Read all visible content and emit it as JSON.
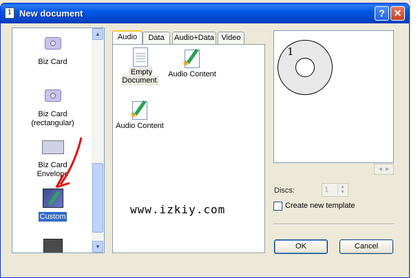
{
  "window": {
    "title": "New document",
    "help_label": "?",
    "close_label": "✕"
  },
  "templates": [
    {
      "label": "Biz Card",
      "icon": "disc-icon"
    },
    {
      "label": "Biz Card (rectangular)",
      "icon": "disc-icon"
    },
    {
      "label": "Biz Card Envelope",
      "icon": "envelope-icon"
    },
    {
      "label": "Custom",
      "icon": "custom-brush-icon",
      "selected": true
    }
  ],
  "tabs": [
    {
      "label": "Audio",
      "active": true
    },
    {
      "label": "Data"
    },
    {
      "label": "Audio+Data"
    },
    {
      "label": "Video"
    }
  ],
  "documents": [
    {
      "label": "Empty Document",
      "icon": "document-icon"
    },
    {
      "label": "Audio Content",
      "icon": "audio-document-icon"
    },
    {
      "label": "Audio Content",
      "icon": "audio-document-icon"
    }
  ],
  "watermark": "www.izkiy.com",
  "preview": {
    "disc_number": "1"
  },
  "discs": {
    "label": "Discs:",
    "value": "1"
  },
  "create_template": {
    "label": "Create new template",
    "checked": false
  },
  "buttons": {
    "ok": "OK",
    "cancel": "Cancel"
  },
  "colors": {
    "title_bar": "#0058e6",
    "selection": "#316ac5",
    "annotation_arrow": "#e01010"
  }
}
